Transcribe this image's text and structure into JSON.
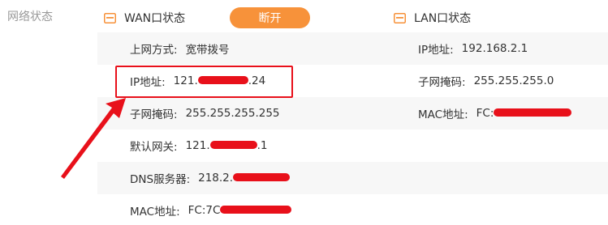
{
  "sidebar": {
    "label": "网络状态"
  },
  "wan": {
    "title": "WAN口状态",
    "icon": "router-icon",
    "disconnect_button": "断开",
    "rows": [
      {
        "label": "上网方式:",
        "value": "宽带拨号"
      },
      {
        "label": "IP地址:",
        "value_prefix": "121.",
        "value_suffix": ".24"
      },
      {
        "label": "子网掩码:",
        "value": "255.255.255.255"
      },
      {
        "label": "默认网关:",
        "value_prefix": "121.",
        "value_suffix": ".1"
      },
      {
        "label": "DNS服务器:",
        "value_prefix": "218.2.",
        "value_suffix": ""
      },
      {
        "label": "MAC地址:",
        "value_prefix": "FC:7C",
        "value_suffix": ""
      }
    ]
  },
  "lan": {
    "title": "LAN口状态",
    "icon": "router-icon",
    "rows": [
      {
        "label": "IP地址:",
        "value": "192.168.2.1"
      },
      {
        "label": "子网掩码:",
        "value": "255.255.255.0"
      },
      {
        "label": "MAC地址:",
        "value_prefix": "FC:",
        "value_suffix": ""
      }
    ]
  },
  "colors": {
    "accent_orange": "#f7923a",
    "annotation_red": "#e8101a",
    "row_shade": "#f7f7f7",
    "muted_text": "#999999"
  }
}
